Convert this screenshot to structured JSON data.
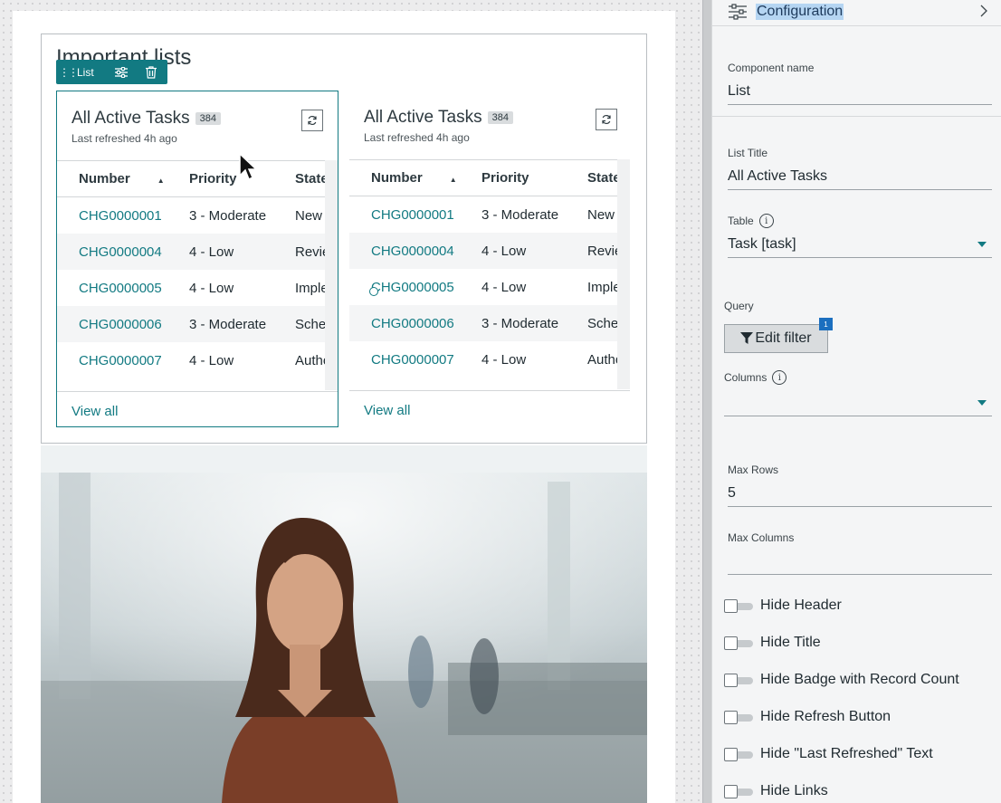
{
  "canvas": {
    "container_title": "Important lists",
    "toolbar": {
      "label": "List"
    },
    "lists": [
      {
        "title": "All Active Tasks",
        "count": "384",
        "refreshed": "Last refreshed 4h ago",
        "columns": [
          "Number",
          "Priority",
          "State"
        ],
        "rows": [
          {
            "number": "CHG0000001",
            "priority": "3 - Moderate",
            "state": "New"
          },
          {
            "number": "CHG0000004",
            "priority": "4 - Low",
            "state": "Review"
          },
          {
            "number": "CHG0000005",
            "priority": "4 - Low",
            "state": "Implement"
          },
          {
            "number": "CHG0000006",
            "priority": "3 - Moderate",
            "state": "Scheduled"
          },
          {
            "number": "CHG0000007",
            "priority": "4 - Low",
            "state": "Authorize"
          }
        ],
        "view_all": "View all"
      },
      {
        "title": "All Active Tasks",
        "count": "384",
        "refreshed": "Last refreshed 4h ago",
        "columns": [
          "Number",
          "Priority",
          "State"
        ],
        "rows": [
          {
            "number": "CHG0000001",
            "priority": "3 - Moderate",
            "state": "New"
          },
          {
            "number": "CHG0000004",
            "priority": "4 - Low",
            "state": "Review"
          },
          {
            "number": "CHG0000005",
            "priority": "4 - Low",
            "state": "Implement"
          },
          {
            "number": "CHG0000006",
            "priority": "3 - Moderate",
            "state": "Scheduled"
          },
          {
            "number": "CHG0000007",
            "priority": "4 - Low",
            "state": "Authorize"
          }
        ],
        "view_all": "View all"
      }
    ]
  },
  "panel": {
    "title": "Configuration",
    "component_name": {
      "label": "Component name",
      "value": "List"
    },
    "list_title": {
      "label": "List Title",
      "value": "All Active Tasks"
    },
    "table": {
      "label": "Table",
      "value": "Task [task]"
    },
    "query": {
      "label": "Query",
      "button": "Edit filter",
      "badge": "1"
    },
    "columns": {
      "label": "Columns",
      "value": ""
    },
    "max_rows": {
      "label": "Max Rows",
      "value": "5"
    },
    "max_columns": {
      "label": "Max Columns",
      "value": ""
    },
    "toggles": [
      {
        "label": "Hide Header",
        "on": false
      },
      {
        "label": "Hide Title",
        "on": false
      },
      {
        "label": "Hide Badge with Record Count",
        "on": false
      },
      {
        "label": "Hide Refresh Button",
        "on": false
      },
      {
        "label": "Hide \"Last Refreshed\" Text",
        "on": false
      },
      {
        "label": "Hide Links",
        "on": false
      }
    ]
  },
  "colors": {
    "accent": "#127a82",
    "link": "#127a82",
    "selection_highlight": "#b5d5f2",
    "badge_blue": "#1b6fbf"
  }
}
